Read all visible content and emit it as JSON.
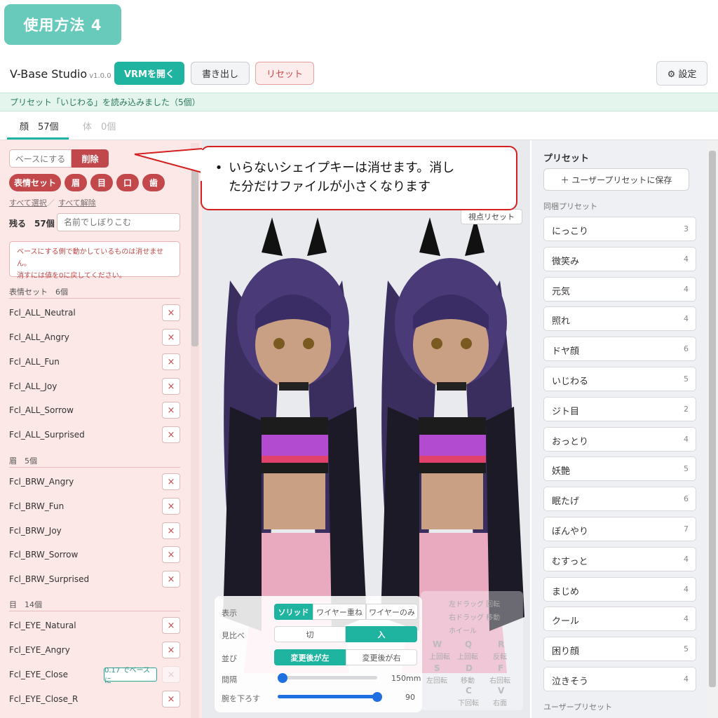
{
  "howto": {
    "label": "使用方法 4"
  },
  "app": {
    "name": "V-Base Studio",
    "version": "v1.0.0"
  },
  "toolbar": {
    "open_label": "VRMを開く",
    "export_label": "書き出し",
    "reset_label": "リセット",
    "settings_label": "⚙ 設定"
  },
  "status": {
    "message": "プリセット「いじわる」を読み込みました（5個）"
  },
  "tabs": [
    {
      "label": "顔　57個",
      "active": true
    },
    {
      "label": "体　0個",
      "active": false
    }
  ],
  "left": {
    "mode_base": "ベースにする",
    "mode_delete": "削除",
    "chips": [
      "表情セット",
      "眉",
      "目",
      "口",
      "歯"
    ],
    "select_all": "すべて選択",
    "separator": "／",
    "deselect_all": "すべて解除",
    "remain": "残る　57個",
    "filter_placeholder": "名前でしぼりこむ",
    "warning_line1": "ベースにする側で動かしているものは消せません。",
    "warning_line2": "消すには値を0に戻してください。",
    "delete_mark": "×",
    "groups": [
      {
        "title": "表情セット　6個",
        "keys": [
          "Fcl_ALL_Neutral",
          "Fcl_ALL_Angry",
          "Fcl_ALL_Fun",
          "Fcl_ALL_Joy",
          "Fcl_ALL_Sorrow",
          "Fcl_ALL_Surprised"
        ]
      },
      {
        "title": "眉　5個",
        "keys": [
          "Fcl_BRW_Angry",
          "Fcl_BRW_Fun",
          "Fcl_BRW_Joy",
          "Fcl_BRW_Sorrow",
          "Fcl_BRW_Surprised"
        ]
      },
      {
        "title": "目　14個",
        "keys": [
          "Fcl_EYE_Natural",
          "Fcl_EYE_Angry",
          "Fcl_EYE_Close",
          "Fcl_EYE_Close_R"
        ]
      }
    ],
    "base_badge": "0.17 でベースに"
  },
  "viewport": {
    "view_reset": "視点リセット",
    "controls": {
      "display_label": "表示",
      "display_options": [
        "ソリッド",
        "ワイヤー重ね",
        "ワイヤーのみ"
      ],
      "compare_label": "見比べ",
      "compare_options": [
        "切",
        "入"
      ],
      "order_label": "並び",
      "order_options": [
        "変更後が左",
        "変更後が右"
      ],
      "spacing_label": "間隔",
      "spacing_value": "150mm",
      "spacing_fraction": 0.05,
      "arm_label": "腕を下ろす",
      "arm_value": "90",
      "arm_fraction": 1.0
    },
    "key_guide": {
      "mouse_left": "左ドラッグ 回転",
      "mouse_right": "右ドラッグ 移動",
      "mouse_wheel": "ホイール",
      "keys": [
        {
          "key": "W",
          "label": "上回転"
        },
        {
          "key": "Q",
          "label": "上回転"
        },
        {
          "key": "R",
          "label": "反転"
        },
        {
          "key": "S",
          "label": "左回転"
        },
        {
          "key": "D",
          "label": "移動"
        },
        {
          "key": "F",
          "label": "右回転"
        },
        {
          "key": "C",
          "label": "下回転"
        },
        {
          "key": "V",
          "label": "右面"
        }
      ]
    }
  },
  "right": {
    "title": "プリセット",
    "save_label": "＋ ユーザープリセットに保存",
    "bundled_title": "同梱プリセット",
    "presets": [
      {
        "name": "にっこり",
        "count": "3"
      },
      {
        "name": "微笑み",
        "count": "4"
      },
      {
        "name": "元気",
        "count": "4"
      },
      {
        "name": "照れ",
        "count": "4"
      },
      {
        "name": "ドヤ顔",
        "count": "6"
      },
      {
        "name": "いじわる",
        "count": "5"
      },
      {
        "name": "ジト目",
        "count": "2"
      },
      {
        "name": "おっとり",
        "count": "4"
      },
      {
        "name": "妖艶",
        "count": "5"
      },
      {
        "name": "眠たげ",
        "count": "6"
      },
      {
        "name": "ぼんやり",
        "count": "7"
      },
      {
        "name": "むすっと",
        "count": "4"
      },
      {
        "name": "まじめ",
        "count": "4"
      },
      {
        "name": "クール",
        "count": "4"
      },
      {
        "name": "困り顔",
        "count": "5"
      },
      {
        "name": "泣きそう",
        "count": "4"
      }
    ],
    "user_title": "ユーザープリセット"
  },
  "callout": {
    "bullet": "•",
    "line1": "いらないシェイプキーは消せます。消し",
    "line2": "た分だけファイルが小さくなります"
  },
  "colors": {
    "accent": "#1fb4a0",
    "danger": "#c2484c",
    "panel_pink": "#fde8e8",
    "callout_border": "#d42020"
  }
}
